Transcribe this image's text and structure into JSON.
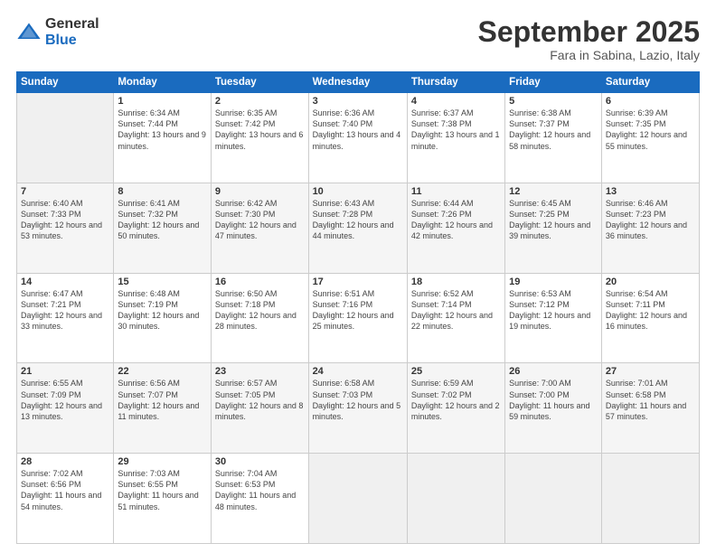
{
  "logo": {
    "general": "General",
    "blue": "Blue"
  },
  "header": {
    "month": "September 2025",
    "location": "Fara in Sabina, Lazio, Italy"
  },
  "days_of_week": [
    "Sunday",
    "Monday",
    "Tuesday",
    "Wednesday",
    "Thursday",
    "Friday",
    "Saturday"
  ],
  "weeks": [
    [
      {
        "day": "",
        "empty": true
      },
      {
        "day": "1",
        "sunrise": "Sunrise: 6:34 AM",
        "sunset": "Sunset: 7:44 PM",
        "daylight": "Daylight: 13 hours and 9 minutes."
      },
      {
        "day": "2",
        "sunrise": "Sunrise: 6:35 AM",
        "sunset": "Sunset: 7:42 PM",
        "daylight": "Daylight: 13 hours and 6 minutes."
      },
      {
        "day": "3",
        "sunrise": "Sunrise: 6:36 AM",
        "sunset": "Sunset: 7:40 PM",
        "daylight": "Daylight: 13 hours and 4 minutes."
      },
      {
        "day": "4",
        "sunrise": "Sunrise: 6:37 AM",
        "sunset": "Sunset: 7:38 PM",
        "daylight": "Daylight: 13 hours and 1 minute."
      },
      {
        "day": "5",
        "sunrise": "Sunrise: 6:38 AM",
        "sunset": "Sunset: 7:37 PM",
        "daylight": "Daylight: 12 hours and 58 minutes."
      },
      {
        "day": "6",
        "sunrise": "Sunrise: 6:39 AM",
        "sunset": "Sunset: 7:35 PM",
        "daylight": "Daylight: 12 hours and 55 minutes."
      }
    ],
    [
      {
        "day": "7",
        "sunrise": "Sunrise: 6:40 AM",
        "sunset": "Sunset: 7:33 PM",
        "daylight": "Daylight: 12 hours and 53 minutes."
      },
      {
        "day": "8",
        "sunrise": "Sunrise: 6:41 AM",
        "sunset": "Sunset: 7:32 PM",
        "daylight": "Daylight: 12 hours and 50 minutes."
      },
      {
        "day": "9",
        "sunrise": "Sunrise: 6:42 AM",
        "sunset": "Sunset: 7:30 PM",
        "daylight": "Daylight: 12 hours and 47 minutes."
      },
      {
        "day": "10",
        "sunrise": "Sunrise: 6:43 AM",
        "sunset": "Sunset: 7:28 PM",
        "daylight": "Daylight: 12 hours and 44 minutes."
      },
      {
        "day": "11",
        "sunrise": "Sunrise: 6:44 AM",
        "sunset": "Sunset: 7:26 PM",
        "daylight": "Daylight: 12 hours and 42 minutes."
      },
      {
        "day": "12",
        "sunrise": "Sunrise: 6:45 AM",
        "sunset": "Sunset: 7:25 PM",
        "daylight": "Daylight: 12 hours and 39 minutes."
      },
      {
        "day": "13",
        "sunrise": "Sunrise: 6:46 AM",
        "sunset": "Sunset: 7:23 PM",
        "daylight": "Daylight: 12 hours and 36 minutes."
      }
    ],
    [
      {
        "day": "14",
        "sunrise": "Sunrise: 6:47 AM",
        "sunset": "Sunset: 7:21 PM",
        "daylight": "Daylight: 12 hours and 33 minutes."
      },
      {
        "day": "15",
        "sunrise": "Sunrise: 6:48 AM",
        "sunset": "Sunset: 7:19 PM",
        "daylight": "Daylight: 12 hours and 30 minutes."
      },
      {
        "day": "16",
        "sunrise": "Sunrise: 6:50 AM",
        "sunset": "Sunset: 7:18 PM",
        "daylight": "Daylight: 12 hours and 28 minutes."
      },
      {
        "day": "17",
        "sunrise": "Sunrise: 6:51 AM",
        "sunset": "Sunset: 7:16 PM",
        "daylight": "Daylight: 12 hours and 25 minutes."
      },
      {
        "day": "18",
        "sunrise": "Sunrise: 6:52 AM",
        "sunset": "Sunset: 7:14 PM",
        "daylight": "Daylight: 12 hours and 22 minutes."
      },
      {
        "day": "19",
        "sunrise": "Sunrise: 6:53 AM",
        "sunset": "Sunset: 7:12 PM",
        "daylight": "Daylight: 12 hours and 19 minutes."
      },
      {
        "day": "20",
        "sunrise": "Sunrise: 6:54 AM",
        "sunset": "Sunset: 7:11 PM",
        "daylight": "Daylight: 12 hours and 16 minutes."
      }
    ],
    [
      {
        "day": "21",
        "sunrise": "Sunrise: 6:55 AM",
        "sunset": "Sunset: 7:09 PM",
        "daylight": "Daylight: 12 hours and 13 minutes."
      },
      {
        "day": "22",
        "sunrise": "Sunrise: 6:56 AM",
        "sunset": "Sunset: 7:07 PM",
        "daylight": "Daylight: 12 hours and 11 minutes."
      },
      {
        "day": "23",
        "sunrise": "Sunrise: 6:57 AM",
        "sunset": "Sunset: 7:05 PM",
        "daylight": "Daylight: 12 hours and 8 minutes."
      },
      {
        "day": "24",
        "sunrise": "Sunrise: 6:58 AM",
        "sunset": "Sunset: 7:03 PM",
        "daylight": "Daylight: 12 hours and 5 minutes."
      },
      {
        "day": "25",
        "sunrise": "Sunrise: 6:59 AM",
        "sunset": "Sunset: 7:02 PM",
        "daylight": "Daylight: 12 hours and 2 minutes."
      },
      {
        "day": "26",
        "sunrise": "Sunrise: 7:00 AM",
        "sunset": "Sunset: 7:00 PM",
        "daylight": "Daylight: 11 hours and 59 minutes."
      },
      {
        "day": "27",
        "sunrise": "Sunrise: 7:01 AM",
        "sunset": "Sunset: 6:58 PM",
        "daylight": "Daylight: 11 hours and 57 minutes."
      }
    ],
    [
      {
        "day": "28",
        "sunrise": "Sunrise: 7:02 AM",
        "sunset": "Sunset: 6:56 PM",
        "daylight": "Daylight: 11 hours and 54 minutes."
      },
      {
        "day": "29",
        "sunrise": "Sunrise: 7:03 AM",
        "sunset": "Sunset: 6:55 PM",
        "daylight": "Daylight: 11 hours and 51 minutes."
      },
      {
        "day": "30",
        "sunrise": "Sunrise: 7:04 AM",
        "sunset": "Sunset: 6:53 PM",
        "daylight": "Daylight: 11 hours and 48 minutes."
      },
      {
        "day": "",
        "empty": true
      },
      {
        "day": "",
        "empty": true
      },
      {
        "day": "",
        "empty": true
      },
      {
        "day": "",
        "empty": true
      }
    ]
  ]
}
